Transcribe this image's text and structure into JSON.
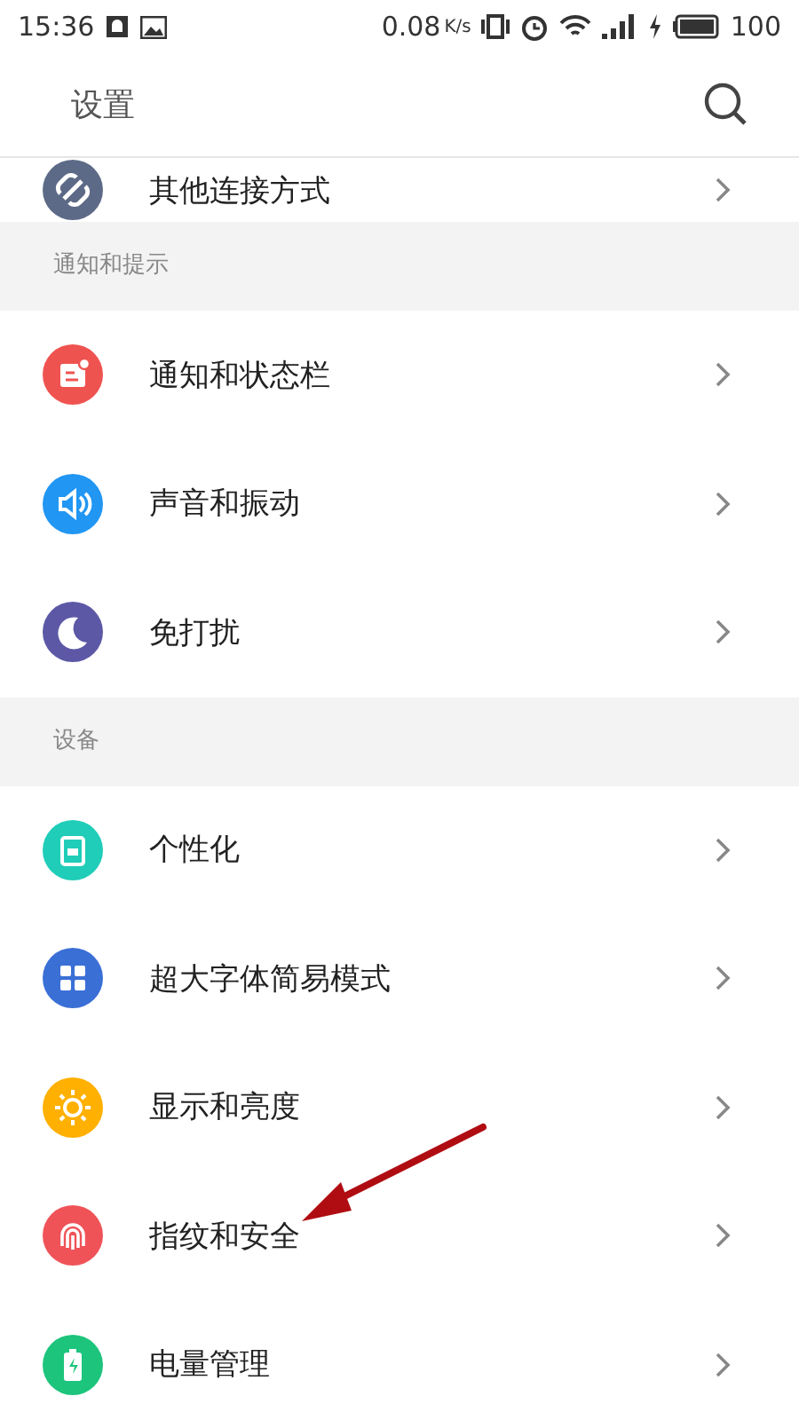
{
  "status_bar": {
    "time": "15:36",
    "speed": "0.08",
    "speed_unit": "K/s",
    "battery": "100"
  },
  "header": {
    "title": "设置"
  },
  "sections": [
    {
      "items": [
        {
          "label": "其他连接方式",
          "kind": "link",
          "color": "#5d6a87"
        }
      ]
    },
    {
      "title": "通知和提示",
      "items": [
        {
          "label": "通知和状态栏",
          "kind": "notification",
          "color": "#ef5350"
        },
        {
          "label": "声音和振动",
          "kind": "sound",
          "color": "#2196f3"
        },
        {
          "label": "免打扰",
          "kind": "moon",
          "color": "#5c58a6"
        }
      ]
    },
    {
      "title": "设备",
      "items": [
        {
          "label": "个性化",
          "kind": "phone",
          "color": "#1fcdb8"
        },
        {
          "label": "超大字体简易模式",
          "kind": "grid",
          "color": "#3a6fd6"
        },
        {
          "label": "显示和亮度",
          "kind": "sun",
          "color": "#ffb000"
        },
        {
          "label": "指纹和安全",
          "kind": "fingerprint",
          "color": "#ef5358"
        },
        {
          "label": "电量管理",
          "kind": "battery",
          "color": "#1cc47c"
        }
      ]
    }
  ]
}
